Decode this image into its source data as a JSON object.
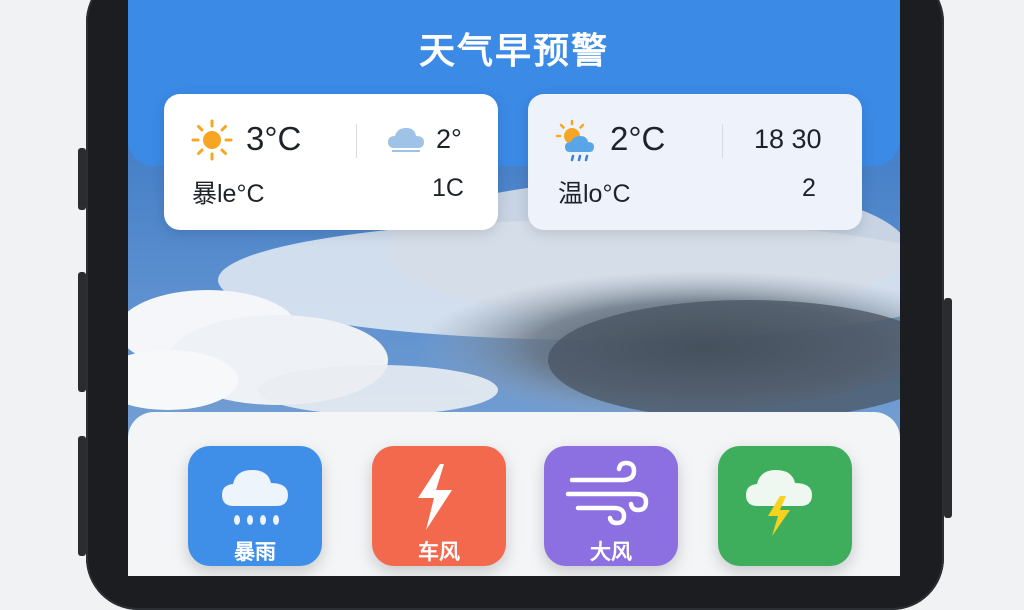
{
  "app": {
    "title": "天气早预警"
  },
  "cards": [
    {
      "main_temp": "3°C",
      "secondary_temp": "2°",
      "sub_left": "暴le°C",
      "sub_right": "1C",
      "main_icon": "sun-icon",
      "secondary_icon": "cloud-icon"
    },
    {
      "main_temp": "2°C",
      "secondary_temp": "18 30",
      "sub_left": "温lo°C",
      "sub_right": "2",
      "main_icon": "partly-cloudy-rain-icon"
    }
  ],
  "alerts": [
    {
      "label": "暴雨",
      "icon": "rain-cloud-icon",
      "color": "#3f8fe8"
    },
    {
      "label": "车风",
      "icon": "lightning-icon",
      "color": "#f2694e"
    },
    {
      "label": "大风",
      "icon": "wind-icon",
      "color": "#8c6fe0"
    },
    {
      "label": "",
      "icon": "thunderstorm-icon",
      "color": "#3fae5c"
    }
  ]
}
